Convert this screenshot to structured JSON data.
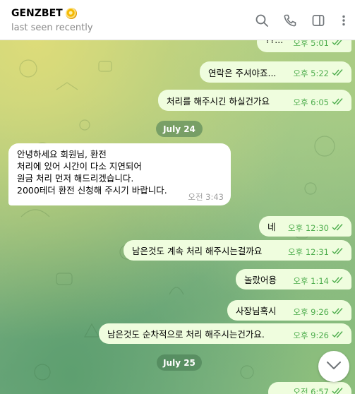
{
  "header": {
    "title": "GENZBET",
    "title_emoji": "cyclone-emoji-icon",
    "status": "last seen recently",
    "icons": [
      "search-icon",
      "phone-icon",
      "sidebar-toggle-icon",
      "more-vertical-icon"
    ]
  },
  "messages": [
    {
      "direction": "out",
      "text": "??...",
      "time": "오후 5:01",
      "read": true
    },
    {
      "direction": "out",
      "text": "연락은 주셔야죠...",
      "time": "오후 5:22",
      "read": true
    },
    {
      "direction": "out",
      "text": "처리를 해주시긴 하실건가요",
      "time": "오후 6:05",
      "read": true
    },
    {
      "direction": "date",
      "text": "July 24"
    },
    {
      "direction": "in",
      "lines": [
        "안녕하세요 회원님, 환전",
        "처리에 있어 시간이 다소 지연되어",
        "원금 처리 먼저 해드리겠습니다.",
        "2000테더 환전 신청해 주시기 바랍니다."
      ],
      "time": "오전 3:43"
    },
    {
      "direction": "out",
      "text": "네",
      "time": "오후 12:30",
      "read": true
    },
    {
      "direction": "out",
      "text": "남은것도 계속 처리 해주시는걸까요",
      "time": "오후 12:31",
      "read": true
    },
    {
      "direction": "out",
      "text": "놀랐어용",
      "time": "오후 1:14",
      "read": true
    },
    {
      "direction": "out",
      "text": "사장님혹시",
      "time": "오후 9:26",
      "read": true
    },
    {
      "direction": "out",
      "text": "남은것도 순차적으로 처리 해주시는건가요.",
      "time": "오후 9:26",
      "read": true
    },
    {
      "direction": "date",
      "text": "July 25"
    },
    {
      "direction": "out",
      "text": "",
      "time": "오전 6:57",
      "read": true
    }
  ],
  "colors": {
    "outgoing_bubble": "#effdde",
    "incoming_bubble": "#ffffff",
    "check_green": "#4fae4e"
  }
}
